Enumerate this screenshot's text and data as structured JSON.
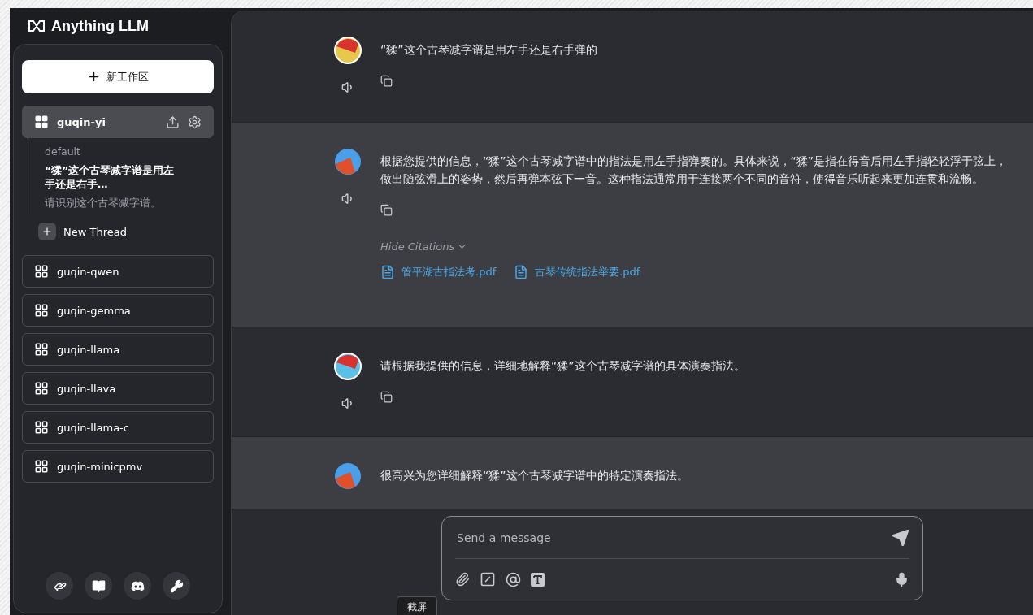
{
  "brand": {
    "name": "Anything LLM"
  },
  "sidebar": {
    "new_workspace_button": "新工作区",
    "workspaces": [
      {
        "name": "guqin-yi",
        "selected": true,
        "threads": [
          {
            "title": "default",
            "selected": false
          },
          {
            "title": "“猱”这个古琴减字谱是用左手还是右手…",
            "selected": true
          },
          {
            "title": "请识别这个古琴减字谱。",
            "selected": false
          }
        ],
        "new_thread": "New Thread"
      },
      {
        "name": "guqin-qwen",
        "selected": false
      },
      {
        "name": "guqin-gemma",
        "selected": false
      },
      {
        "name": "guqin-llama",
        "selected": false
      },
      {
        "name": "guqin-llava",
        "selected": false
      },
      {
        "name": "guqin-llama-c",
        "selected": false
      },
      {
        "name": "guqin-minicpmv",
        "selected": false
      }
    ]
  },
  "chat": {
    "messages": [
      {
        "kind": "user",
        "color": "#e8c84a",
        "text": "“猱”这个古琴减字谱是用左手还是右手弹的"
      },
      {
        "kind": "assistant",
        "color": "#4a9fe8",
        "text": "根据您提供的信息，“猱”这个古琴减字谱中的指法是用左手指弹奏的。具体来说，“猱”是指在得音后用左手指轻轻浮于弦上，做出随弦滑上的姿势，然后再弹本弦下一音。这种指法通常用于连接两个不同的音符，使得音乐听起来更加连贯和流畅。",
        "citations_toggle": "Hide Citations",
        "citations": [
          "管平湖古指法考.pdf",
          "古琴传统指法举要.pdf"
        ]
      },
      {
        "kind": "user",
        "color": "#5bc0e8",
        "text": "请根据我提供的信息，详细地解释“猱”这个古琴减字谱的具体演奏指法。"
      },
      {
        "kind": "assistant",
        "color": "#4a9fe8",
        "text": "很高兴为您详细解释“猱”这个古琴减字谱中的特定演奏指法。"
      }
    ]
  },
  "composer": {
    "placeholder": "Send a message"
  },
  "tooltip": "截屏"
}
